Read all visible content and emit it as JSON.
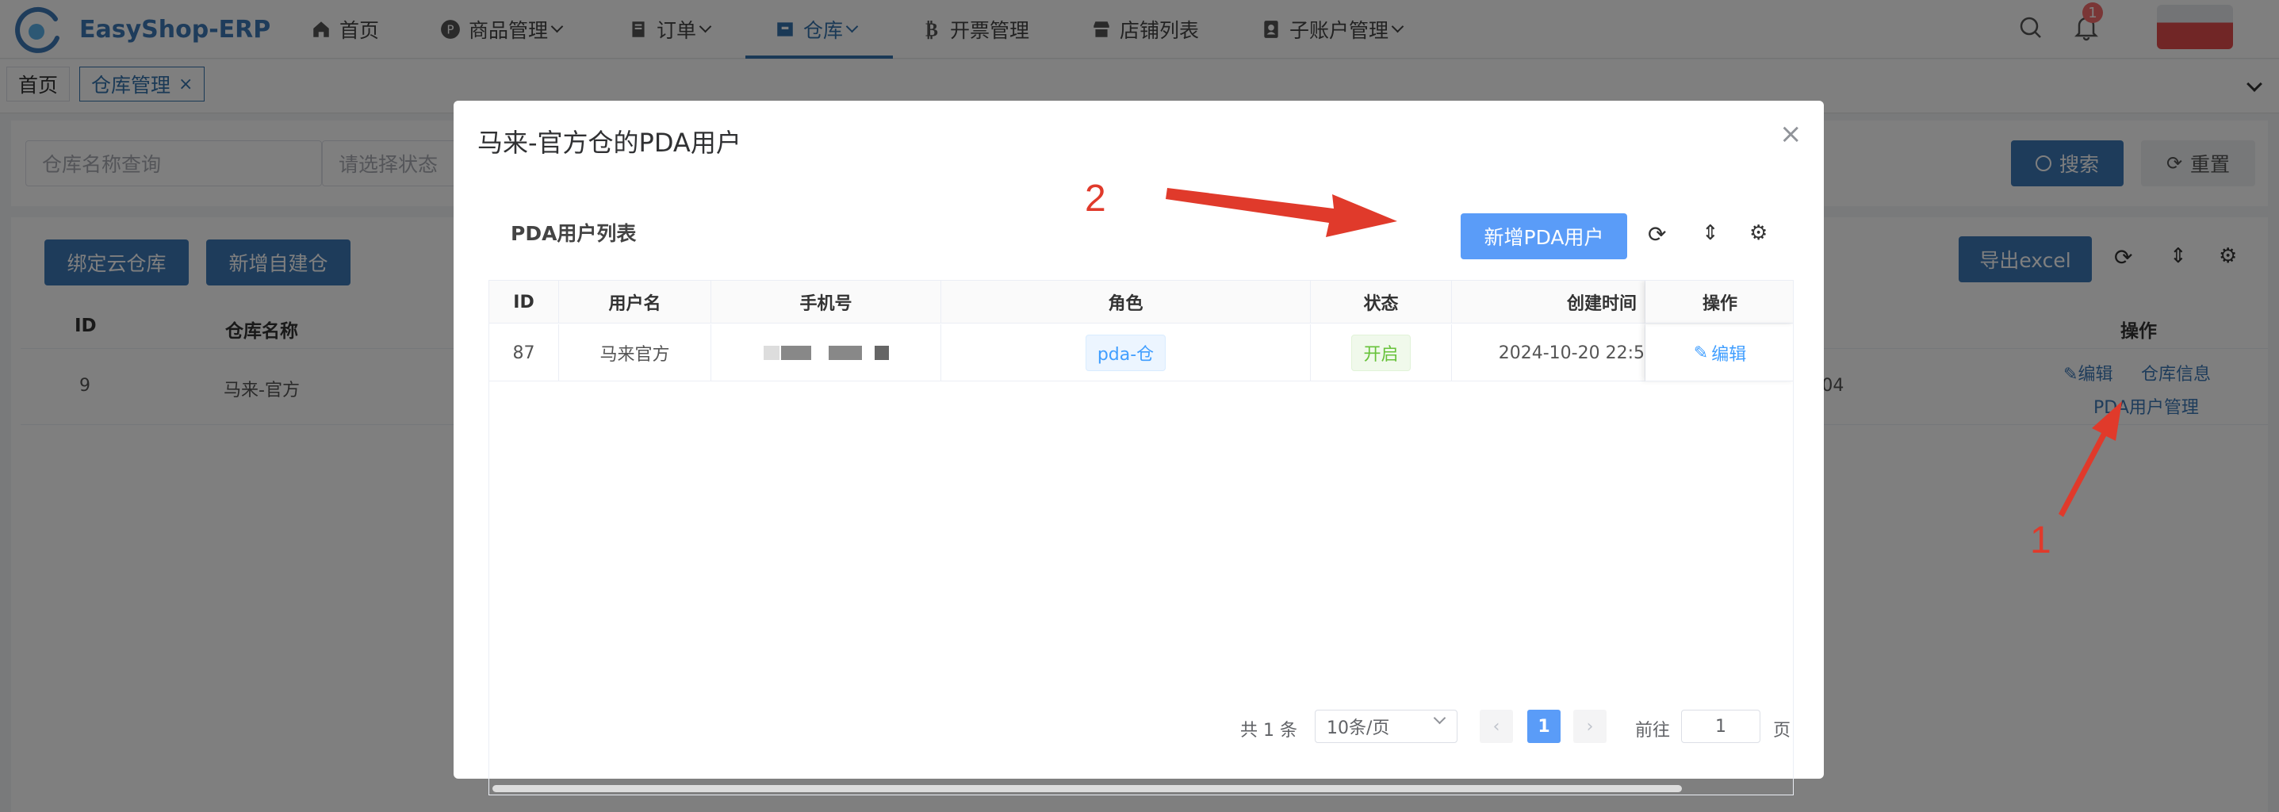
{
  "app": {
    "name": "EasyShop-ERP"
  },
  "nav": {
    "items": [
      {
        "label": "首页"
      },
      {
        "label": "商品管理"
      },
      {
        "label": "订单"
      },
      {
        "label": "仓库"
      },
      {
        "label": "开票管理"
      },
      {
        "label": "店铺列表"
      },
      {
        "label": "子账户管理"
      }
    ],
    "notification_count": "1"
  },
  "tabs": [
    {
      "label": "首页"
    },
    {
      "label": "仓库管理"
    }
  ],
  "filters": {
    "name_placeholder": "仓库名称查询",
    "status_placeholder": "请选择状态",
    "search_label": "搜索",
    "reset_label": "重置"
  },
  "toolbar": {
    "bind_cloud": "绑定云仓库",
    "add_self": "新增自建仓",
    "export": "导出excel"
  },
  "bg_table": {
    "headers": {
      "id": "ID",
      "name": "仓库名称",
      "actions": "操作"
    },
    "row": {
      "id": "9",
      "name": "马来-官方",
      "time_fragment": ":04",
      "edit": "编辑",
      "info": "仓库信息",
      "pda": "PDA用户管理"
    }
  },
  "modal": {
    "title": "马来-官方仓的PDA用户",
    "list_title": "PDA用户列表",
    "add_button": "新增PDA用户",
    "columns": [
      "ID",
      "用户名",
      "手机号",
      "角色",
      "状态",
      "创建时间",
      "操作"
    ],
    "rows": [
      {
        "id": "87",
        "username": "马来官方",
        "role": "pda-仓",
        "status": "开启",
        "created": "2024-10-20 22:5",
        "action": "编辑"
      }
    ],
    "pagination": {
      "total": "共 1 条",
      "page_size": "10条/页",
      "current": "1",
      "goto_label": "前往",
      "goto_value": "1",
      "page_suffix": "页"
    }
  },
  "annotations": {
    "arrow1": "1",
    "arrow2": "2"
  },
  "colors": {
    "primary": "#3d78b6",
    "modal_primary": "#5a9cf8",
    "annotation": "#e03a2b",
    "success": "#67c23a"
  }
}
